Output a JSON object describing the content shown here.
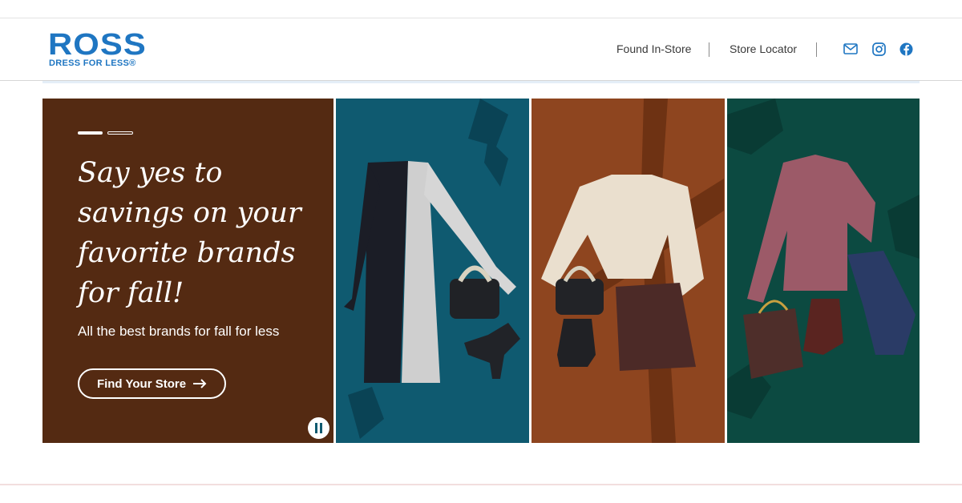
{
  "brand": {
    "name": "ROSS",
    "tagline": "DRESS FOR LESS®",
    "color": "#1f76c2"
  },
  "nav": {
    "found_in_store": "Found In-Store",
    "store_locator": "Store Locator",
    "icons": [
      "mail-icon",
      "instagram-icon",
      "facebook-icon"
    ]
  },
  "hero": {
    "headline": "Say yes to savings on your favorite brands for fall!",
    "subline": "All the best brands for fall for less",
    "cta_label": "Find Your Store",
    "cta_icon": "arrow-right-icon",
    "carousel": {
      "slides": 2,
      "active": 1
    },
    "panel_colors": {
      "text": "#542a12",
      "teal": "#0f5a70",
      "rust": "#8e451f",
      "green": "#0c4a41"
    }
  }
}
